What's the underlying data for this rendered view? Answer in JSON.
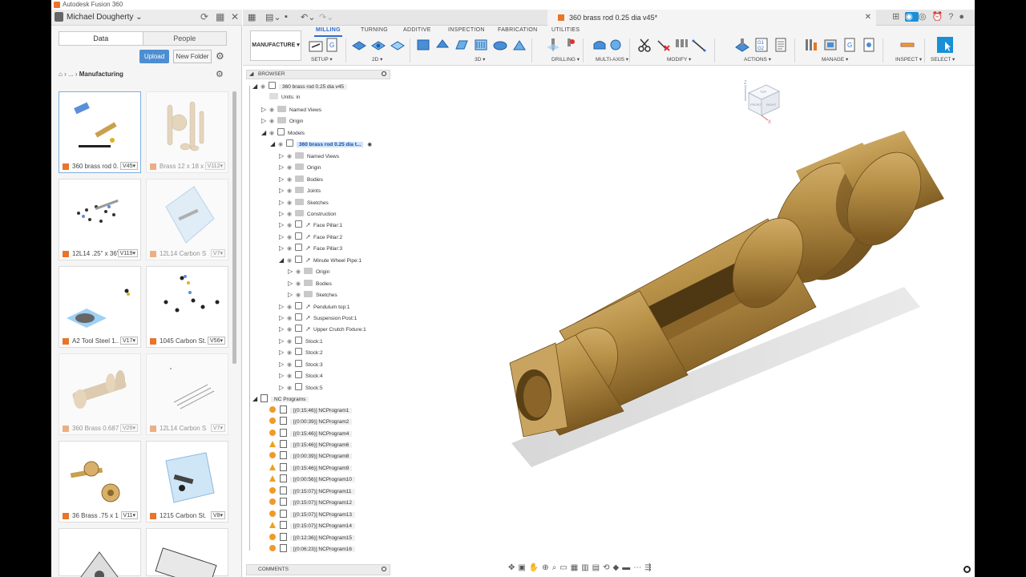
{
  "app": {
    "title": "Autodesk Fusion 360"
  },
  "data_panel": {
    "user_name": "Michael Dougherty",
    "tabs": [
      "Data",
      "People"
    ],
    "upload_label": "Upload",
    "new_folder_label": "New Folder",
    "breadcrumb": [
      "...",
      "Manufacturing"
    ],
    "files": [
      {
        "name": "360 brass rod 0...",
        "version": "V45",
        "dim": false
      },
      {
        "name": "Brass 12 x 18 x ...",
        "version": "V112",
        "dim": true
      },
      {
        "name": "12L14 .25\" x 36\"",
        "version": "V119",
        "dim": false
      },
      {
        "name": "12L14 Carbon S...",
        "version": "V7",
        "dim": true
      },
      {
        "name": "A2 Tool Steel 1...",
        "version": "V17",
        "dim": false
      },
      {
        "name": "1045 Carbon St...",
        "version": "V56",
        "dim": false
      },
      {
        "name": "360 Brass 0.687...",
        "version": "V26",
        "dim": true
      },
      {
        "name": "12L14 Carbon S...",
        "version": "V7",
        "dim": true
      },
      {
        "name": "36 Brass .75 x 12",
        "version": "V11",
        "dim": false
      },
      {
        "name": "1215 Carbon St...",
        "version": "V8",
        "dim": false
      }
    ]
  },
  "document": {
    "tab_title": "360 brass rod 0.25 dia v45*"
  },
  "toolbar": {
    "workspace": "MANUFACTURE",
    "tabs": [
      "MILLING",
      "TURNING",
      "ADDITIVE",
      "INSPECTION",
      "FABRICATION",
      "UTILITIES"
    ],
    "groups": [
      "SETUP",
      "2D",
      "3D",
      "DRILLING",
      "MULTI-AXIS",
      "MODIFY",
      "ACTIONS",
      "MANAGE",
      "INSPECT",
      "SELECT"
    ]
  },
  "browser": {
    "title": "BROWSER",
    "comments_label": "COMMENTS",
    "tree": [
      {
        "label": "360 brass rod 0.25 dia v45",
        "indent": 0,
        "twisty": "open",
        "type": "doc"
      },
      {
        "label": "Units: in",
        "indent": 1,
        "twisty": "",
        "type": "units"
      },
      {
        "label": "Named Views",
        "indent": 1,
        "twisty": "closed",
        "type": "folder"
      },
      {
        "label": "Origin",
        "indent": 1,
        "twisty": "closed",
        "type": "folder"
      },
      {
        "label": "Models",
        "indent": 1,
        "twisty": "open",
        "type": "folder-cube"
      },
      {
        "label": "360 brass rod 0.25 dia t...",
        "indent": 2,
        "twisty": "open",
        "type": "component-hl"
      },
      {
        "label": "Named Views",
        "indent": 3,
        "twisty": "closed",
        "type": "folder"
      },
      {
        "label": "Origin",
        "indent": 3,
        "twisty": "closed",
        "type": "folder"
      },
      {
        "label": "Bodies",
        "indent": 3,
        "twisty": "closed",
        "type": "folder"
      },
      {
        "label": "Joints",
        "indent": 3,
        "twisty": "closed",
        "type": "folder"
      },
      {
        "label": "Sketches",
        "indent": 3,
        "twisty": "closed",
        "type": "folder"
      },
      {
        "label": "Construction",
        "indent": 3,
        "twisty": "closed",
        "type": "folder"
      },
      {
        "label": "Face Pillar:1",
        "indent": 3,
        "twisty": "closed",
        "type": "link"
      },
      {
        "label": "Face Pillar:2",
        "indent": 3,
        "twisty": "closed",
        "type": "link"
      },
      {
        "label": "Face Pillar:3",
        "indent": 3,
        "twisty": "closed",
        "type": "link"
      },
      {
        "label": "Minute Wheel Pipe:1",
        "indent": 3,
        "twisty": "open",
        "type": "link"
      },
      {
        "label": "Origin",
        "indent": 4,
        "twisty": "closed",
        "type": "folder"
      },
      {
        "label": "Bodies",
        "indent": 4,
        "twisty": "closed",
        "type": "folder"
      },
      {
        "label": "Sketches",
        "indent": 4,
        "twisty": "closed",
        "type": "folder"
      },
      {
        "label": "Pendulum top:1",
        "indent": 3,
        "twisty": "closed",
        "type": "link"
      },
      {
        "label": "Suspension Post:1",
        "indent": 3,
        "twisty": "closed",
        "type": "link"
      },
      {
        "label": "Upper Crutch Fixture:1",
        "indent": 3,
        "twisty": "closed",
        "type": "link"
      },
      {
        "label": "Stock:1",
        "indent": 3,
        "twisty": "closed",
        "type": "stock"
      },
      {
        "label": "Stock:2",
        "indent": 3,
        "twisty": "closed",
        "type": "stock"
      },
      {
        "label": "Stock:3",
        "indent": 3,
        "twisty": "closed",
        "type": "stock"
      },
      {
        "label": "Stock:4",
        "indent": 3,
        "twisty": "closed",
        "type": "stock"
      },
      {
        "label": "Stock:5",
        "indent": 3,
        "twisty": "closed",
        "type": "stock"
      },
      {
        "label": "NC Programs",
        "indent": 0,
        "twisty": "open",
        "type": "nc-root"
      },
      {
        "label": "[(0:15:46)] NCProgram1",
        "indent": 1,
        "twisty": "",
        "type": "nc-ok"
      },
      {
        "label": "[(0:00:39)] NCProgram2",
        "indent": 1,
        "twisty": "",
        "type": "nc-ok"
      },
      {
        "label": "[(0:15:46)] NCProgram4",
        "indent": 1,
        "twisty": "",
        "type": "nc-ok"
      },
      {
        "label": "[(0:15:46)] NCProgram6",
        "indent": 1,
        "twisty": "",
        "type": "nc-warn"
      },
      {
        "label": "[(0:00:39)] NCProgram8",
        "indent": 1,
        "twisty": "",
        "type": "nc-ok"
      },
      {
        "label": "[(0:15:46)] NCProgram9",
        "indent": 1,
        "twisty": "",
        "type": "nc-warn"
      },
      {
        "label": "[(0:00:56)] NCProgram10",
        "indent": 1,
        "twisty": "",
        "type": "nc-warn"
      },
      {
        "label": "[(0:15:07)] NCProgram11",
        "indent": 1,
        "twisty": "",
        "type": "nc-ok"
      },
      {
        "label": "[(0:15:07)] NCProgram12",
        "indent": 1,
        "twisty": "",
        "type": "nc-ok"
      },
      {
        "label": "[(0:15:07)] NCProgram13",
        "indent": 1,
        "twisty": "",
        "type": "nc-ok"
      },
      {
        "label": "[(0:15:07)] NCProgram14",
        "indent": 1,
        "twisty": "",
        "type": "nc-warn"
      },
      {
        "label": "[(0:12:36)] NCProgram15",
        "indent": 1,
        "twisty": "",
        "type": "nc-ok"
      },
      {
        "label": "[(0:06:23)] NCProgram16",
        "indent": 1,
        "twisty": "",
        "type": "nc-ok"
      }
    ]
  },
  "viewcube": {
    "faces": [
      "TOP",
      "FRONT",
      "RIGHT"
    ],
    "axes": [
      "Z",
      "X"
    ]
  },
  "colors": {
    "accent": "#2a6dd1",
    "brass": "#b89148",
    "upload": "#4d8ed1"
  }
}
